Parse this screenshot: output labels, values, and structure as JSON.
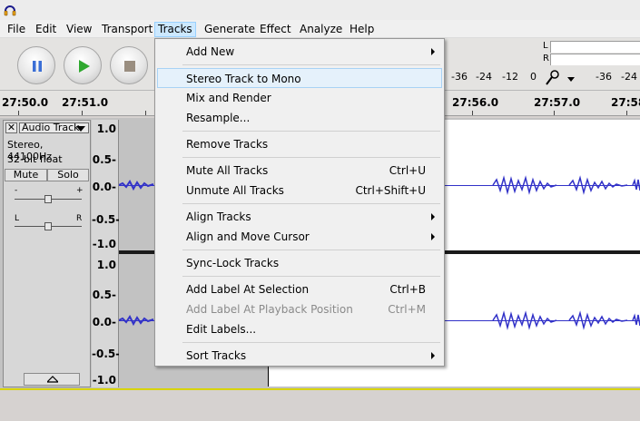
{
  "menubar": {
    "items": [
      {
        "label": "File"
      },
      {
        "label": "Edit"
      },
      {
        "label": "View"
      },
      {
        "label": "Transport"
      },
      {
        "label": "Tracks"
      },
      {
        "label": "Generate"
      },
      {
        "label": "Effect"
      },
      {
        "label": "Analyze"
      },
      {
        "label": "Help"
      }
    ],
    "active": "Tracks"
  },
  "toolbar": {
    "buttons": [
      {
        "icon": "pause-icon"
      },
      {
        "icon": "play-icon"
      },
      {
        "icon": "stop-icon"
      }
    ],
    "colors": {
      "pause": "#3b6fd6",
      "play": "#2fa82f",
      "stop": "#9a8e80"
    }
  },
  "meter": {
    "left_label": "L",
    "right_label": "R",
    "scale_left": [
      "-36",
      "-24",
      "-12",
      "0"
    ],
    "scale_right": [
      "-36",
      "-24"
    ]
  },
  "ruler": {
    "ticks": [
      "27:50.0",
      "27:51.0",
      "27:56.0",
      "27:57.0",
      "27:58."
    ]
  },
  "track": {
    "close": "✕",
    "name": "Audio Track",
    "info_line1": "Stereo, 44100Hz",
    "info_line2": "32-bit float",
    "mute_label": "Mute",
    "solo_label": "Solo",
    "gain_minus": "-",
    "gain_plus": "+",
    "pan_left": "L",
    "pan_right": "R"
  },
  "vruler": {
    "top": [
      "1.0",
      "0.5-",
      "0.0-",
      "-0.5-",
      "-1.0"
    ],
    "bottom": [
      "1.0",
      "0.5-",
      "0.0-",
      "-0.5-",
      "-1.0"
    ]
  },
  "tracks_menu": {
    "items": [
      {
        "label": "Add New",
        "shortcut": "",
        "submenu": true,
        "disabled": false,
        "highlighted": false
      },
      {
        "label": "Stereo Track to Mono",
        "shortcut": "",
        "submenu": false,
        "disabled": false,
        "highlighted": true
      },
      {
        "label": "Mix and Render",
        "shortcut": "",
        "submenu": false,
        "disabled": false,
        "highlighted": false
      },
      {
        "label": "Resample...",
        "shortcut": "",
        "submenu": false,
        "disabled": false,
        "highlighted": false
      },
      {
        "label": "Remove Tracks",
        "shortcut": "",
        "submenu": false,
        "disabled": false,
        "highlighted": false
      },
      {
        "label": "Mute All Tracks",
        "shortcut": "Ctrl+U",
        "submenu": false,
        "disabled": false,
        "highlighted": false
      },
      {
        "label": "Unmute All Tracks",
        "shortcut": "Ctrl+Shift+U",
        "submenu": false,
        "disabled": false,
        "highlighted": false
      },
      {
        "label": "Align Tracks",
        "shortcut": "",
        "submenu": true,
        "disabled": false,
        "highlighted": false
      },
      {
        "label": "Align and Move Cursor",
        "shortcut": "",
        "submenu": true,
        "disabled": false,
        "highlighted": false
      },
      {
        "label": "Sync-Lock Tracks",
        "shortcut": "",
        "submenu": false,
        "disabled": false,
        "highlighted": false
      },
      {
        "label": "Add Label At Selection",
        "shortcut": "Ctrl+B",
        "submenu": false,
        "disabled": false,
        "highlighted": false
      },
      {
        "label": "Add Label At Playback Position",
        "shortcut": "Ctrl+M",
        "submenu": false,
        "disabled": true,
        "highlighted": false
      },
      {
        "label": "Edit Labels...",
        "shortcut": "",
        "submenu": false,
        "disabled": false,
        "highlighted": false
      },
      {
        "label": "Sort Tracks",
        "shortcut": "",
        "submenu": true,
        "disabled": false,
        "highlighted": false
      }
    ]
  },
  "colors": {
    "waveform": "#3232c8",
    "selection": "#c2c2c2",
    "menu_highlight": "#e5f1fb",
    "border_accent": "#d8d400"
  }
}
